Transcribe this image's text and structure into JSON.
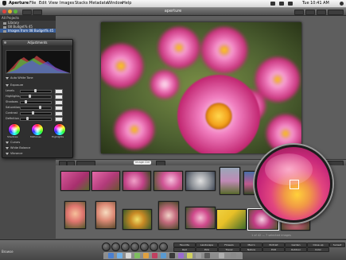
{
  "menu": {
    "app": "Aperture",
    "items": [
      "File",
      "Edit",
      "View",
      "Images",
      "Stacks",
      "Metadata",
      "Window",
      "Help"
    ],
    "clock": "Tue 10:41 AM"
  },
  "window": {
    "title": "aperture"
  },
  "projects": {
    "header": "All Projects",
    "rows": [
      "Library",
      "08 Budget% 45",
      "Images from 08 Budget% 45"
    ]
  },
  "adjustments": {
    "title": "Adjustments",
    "rows": [
      "Auto White Tone",
      "Exposure",
      "Levels",
      "Highlights",
      "Shadows",
      "Saturation",
      "Contrast",
      "Definition"
    ],
    "sections": [
      "Curves",
      "White Balance",
      "Vibrance"
    ],
    "wheel_labels": [
      "Shadows",
      "Midtones",
      "Highlights"
    ]
  },
  "controls": {
    "search_placeholder": "Image Ctrl"
  },
  "browser": {
    "footer": "1 of 42 — 7 selected images"
  },
  "keywords": [
    "Favorite",
    "Landscape",
    "Flowers",
    "Macro",
    "Portrait",
    "Red",
    "Pink",
    "Travel",
    "Nature",
    "Edit",
    "Garden",
    "Outdoor",
    "Close-up",
    "Color",
    "Sunset"
  ],
  "status": {
    "mode": "Browse"
  },
  "icons": [
    "apple-icon",
    "wifi-icon",
    "volume-icon",
    "spotlight-icon",
    "close-icon",
    "search-icon"
  ]
}
